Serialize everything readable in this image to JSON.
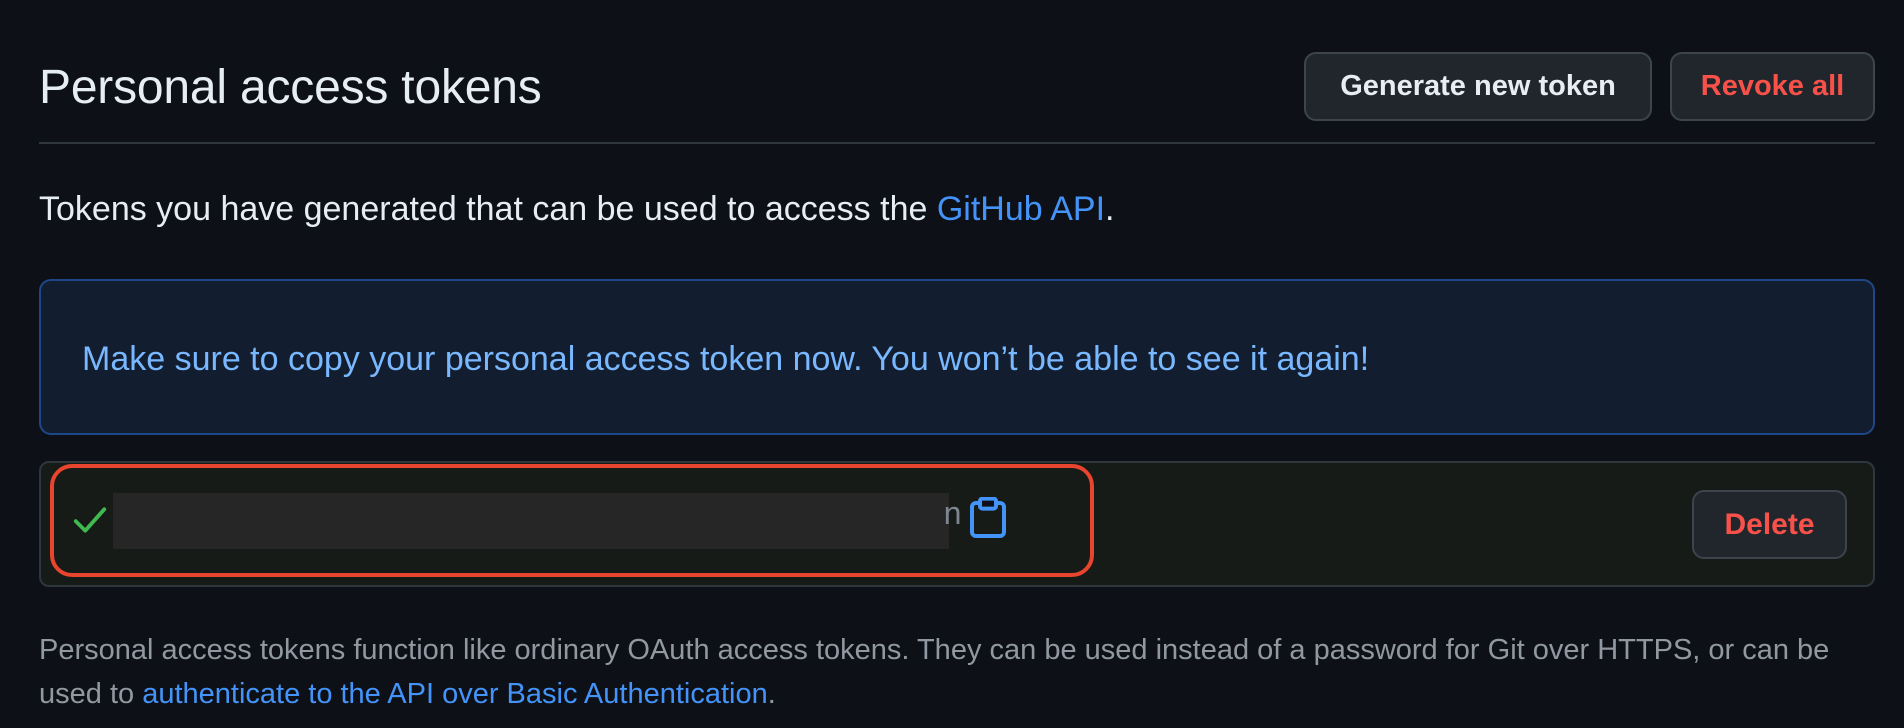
{
  "header": {
    "title": "Personal access tokens",
    "generate_button": "Generate new token",
    "revoke_button": "Revoke all"
  },
  "intro": {
    "text_before": "Tokens you have generated that can be used to access the ",
    "link_text": "GitHub API",
    "text_after": "."
  },
  "flash": {
    "message": "Make sure to copy your personal access token now. You won’t be able to see it again!"
  },
  "token_row": {
    "token_value": "",
    "token_tail": "n",
    "check_icon": "check-icon",
    "copy_icon": "clipboard-icon",
    "delete_button": "Delete"
  },
  "note": {
    "text_before": "Personal access tokens function like ordinary OAuth access tokens. They can be used instead of a password for Git over HTTPS, or can be used to ",
    "link_text": "authenticate to the API over Basic Authentication",
    "text_after": "."
  },
  "colors": {
    "background": "#0d1117",
    "link": "#4493f8",
    "danger": "#f85149",
    "flash_text": "#79b8ff",
    "success": "#3fb950",
    "highlight": "#e8442e"
  }
}
